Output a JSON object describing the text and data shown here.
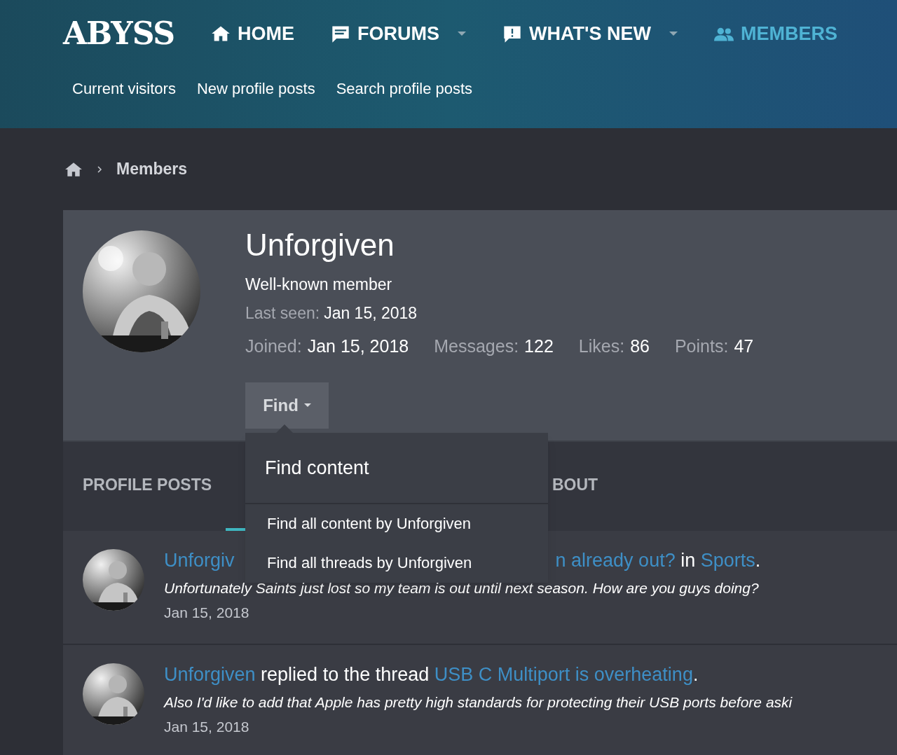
{
  "logo": "ABYSS",
  "nav": [
    {
      "label": "HOME",
      "kind": "home",
      "caret": false,
      "selected": false
    },
    {
      "label": "FORUMS",
      "kind": "forums",
      "caret": true,
      "selected": false
    },
    {
      "label": "WHAT'S NEW",
      "kind": "alert",
      "caret": true,
      "selected": false
    },
    {
      "label": "MEMBERS",
      "kind": "members",
      "caret": false,
      "selected": true
    }
  ],
  "subnav": [
    "Current visitors",
    "New profile posts",
    "Search profile posts"
  ],
  "breadcrumb": [
    "Members"
  ],
  "profile": {
    "name": "Unforgiven",
    "title": "Well-known member",
    "last_seen": {
      "label": "Last seen:",
      "value": "Jan 15, 2018"
    },
    "stats": [
      {
        "label": "Joined:",
        "value": "Jan 15, 2018"
      },
      {
        "label": "Messages:",
        "value": "122"
      },
      {
        "label": "Likes:",
        "value": "86"
      },
      {
        "label": "Points:",
        "value": "47"
      }
    ],
    "find_button": "Find"
  },
  "dropdown": {
    "header": "Find content",
    "items": [
      "Find all content by Unforgiven",
      "Find all threads by Unforgiven"
    ]
  },
  "tabs": [
    {
      "label": "PROFILE POSTS",
      "selected": false
    },
    {
      "selected": true
    },
    {
      "label": "BOUT",
      "selected": false
    }
  ],
  "posts": [
    {
      "parts": [
        {
          "kind": "link",
          "text": "Unforgiv"
        },
        {
          "kind": "gap"
        },
        {
          "kind": "link",
          "text": "n already out?"
        },
        {
          "kind": "text",
          "text": " in "
        },
        {
          "kind": "link",
          "text": "Sports"
        },
        {
          "kind": "text",
          "text": "."
        }
      ],
      "excerpt": "Unfortunately Saints just lost so my team is out until next season. How are you guys doing?",
      "date": "Jan 15, 2018"
    },
    {
      "parts": [
        {
          "kind": "link",
          "text": "Unforgiven"
        },
        {
          "kind": "text",
          "text": " replied to the thread "
        },
        {
          "kind": "link",
          "text": "USB C Multiport is overheating"
        },
        {
          "kind": "text",
          "text": "."
        }
      ],
      "excerpt": "Also I'd like to add that Apple has pretty high standards for protecting their USB ports before aski",
      "date": "Jan 15, 2018"
    }
  ]
}
